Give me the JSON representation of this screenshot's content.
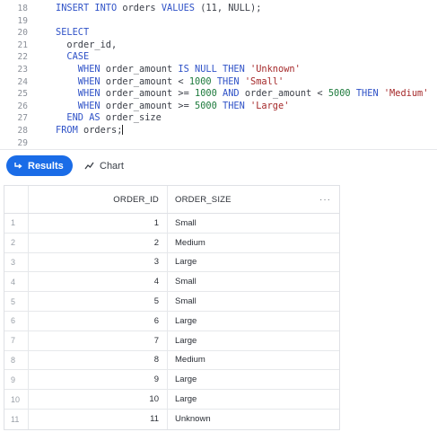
{
  "editor": {
    "lines": [
      {
        "no": "18",
        "tokens": [
          {
            "t": "kw",
            "v": "INSERT INTO"
          },
          {
            "t": "txt",
            "v": " orders "
          },
          {
            "t": "kw",
            "v": "VALUES"
          },
          {
            "t": "txt",
            "v": " (11, NULL);"
          }
        ]
      },
      {
        "no": "19",
        "tokens": []
      },
      {
        "no": "20",
        "tokens": [
          {
            "t": "kw",
            "v": "SELECT"
          }
        ]
      },
      {
        "no": "21",
        "tokens": [
          {
            "t": "txt",
            "v": "  order_id,"
          }
        ]
      },
      {
        "no": "22",
        "tokens": [
          {
            "t": "kw",
            "v": "  CASE"
          }
        ]
      },
      {
        "no": "23",
        "tokens": [
          {
            "t": "kw",
            "v": "    WHEN"
          },
          {
            "t": "txt",
            "v": " order_amount "
          },
          {
            "t": "kw",
            "v": "IS NULL THEN"
          },
          {
            "t": "str",
            "v": " 'Unknown'"
          }
        ]
      },
      {
        "no": "24",
        "tokens": [
          {
            "t": "kw",
            "v": "    WHEN"
          },
          {
            "t": "txt",
            "v": " order_amount < "
          },
          {
            "t": "num",
            "v": "1000"
          },
          {
            "t": "kw",
            "v": " THEN"
          },
          {
            "t": "str",
            "v": " 'Small'"
          }
        ]
      },
      {
        "no": "25",
        "tokens": [
          {
            "t": "kw",
            "v": "    WHEN"
          },
          {
            "t": "txt",
            "v": " order_amount >= "
          },
          {
            "t": "num",
            "v": "1000"
          },
          {
            "t": "kw",
            "v": " AND"
          },
          {
            "t": "txt",
            "v": " order_amount < "
          },
          {
            "t": "num",
            "v": "5000"
          },
          {
            "t": "kw",
            "v": " THEN"
          },
          {
            "t": "str",
            "v": " 'Medium'"
          }
        ]
      },
      {
        "no": "26",
        "tokens": [
          {
            "t": "kw",
            "v": "    WHEN"
          },
          {
            "t": "txt",
            "v": " order_amount >= "
          },
          {
            "t": "num",
            "v": "5000"
          },
          {
            "t": "kw",
            "v": " THEN"
          },
          {
            "t": "str",
            "v": " 'Large'"
          }
        ]
      },
      {
        "no": "27",
        "tokens": [
          {
            "t": "kw",
            "v": "  END AS"
          },
          {
            "t": "txt",
            "v": " order_size"
          }
        ]
      },
      {
        "no": "28",
        "tokens": [
          {
            "t": "kw",
            "v": "FROM"
          },
          {
            "t": "txt",
            "v": " orders;"
          },
          {
            "t": "cursor",
            "v": ""
          }
        ]
      },
      {
        "no": "29",
        "tokens": []
      }
    ]
  },
  "toolbar": {
    "results_label": "Results",
    "chart_label": "Chart"
  },
  "grid": {
    "columns": [
      "ORDER_ID",
      "ORDER_SIZE"
    ],
    "more_label": "···",
    "rows": [
      {
        "idx": "1",
        "order_id": "1",
        "order_size": "Small"
      },
      {
        "idx": "2",
        "order_id": "2",
        "order_size": "Medium"
      },
      {
        "idx": "3",
        "order_id": "3",
        "order_size": "Large"
      },
      {
        "idx": "4",
        "order_id": "4",
        "order_size": "Small"
      },
      {
        "idx": "5",
        "order_id": "5",
        "order_size": "Small"
      },
      {
        "idx": "6",
        "order_id": "6",
        "order_size": "Large"
      },
      {
        "idx": "7",
        "order_id": "7",
        "order_size": "Large"
      },
      {
        "idx": "8",
        "order_id": "8",
        "order_size": "Medium"
      },
      {
        "idx": "9",
        "order_id": "9",
        "order_size": "Large"
      },
      {
        "idx": "10",
        "order_id": "10",
        "order_size": "Large"
      },
      {
        "idx": "11",
        "order_id": "11",
        "order_size": "Unknown"
      }
    ]
  }
}
